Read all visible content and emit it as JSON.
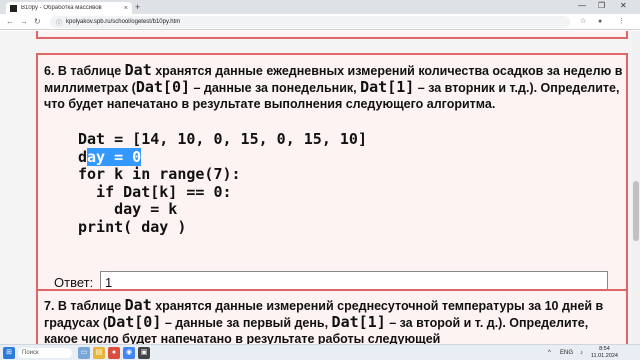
{
  "browser": {
    "tab_title": "B10py - Обработка массивов",
    "tab_close": "×",
    "new_tab": "+",
    "url": "kpolyakov.spb.ru/school/ogetest/b10py.htm",
    "win_min": "—",
    "win_max": "❐",
    "win_close": "✕"
  },
  "task6": {
    "number": "6.",
    "intro1": " В таблице ",
    "arr": "Dat",
    "intro2": " хранятся данные ежедневных измерений количества осадков за неделю в миллиметрах (",
    "arr0": "Dat[0]",
    "intro3": " – данные за понедельник, ",
    "arr1": "Dat[1]",
    "intro4": " – за вторник и т.д.). Определите, что будет напечатано в результате выполнения следующего алгоритма.",
    "code": {
      "line1": "Dat = [14, 10, 0, 15, 0, 15, 10]",
      "line2_pre": "d",
      "line2_sel": "ay = 0",
      "line3": "for k in range(7):",
      "line4": "  if Dat[k] == 0:",
      "line5": "    day = k",
      "line6": "print( day )"
    },
    "answer_label": "Ответ:",
    "answer_value": "1"
  },
  "task7": {
    "number": "7.",
    "intro1": " В таблице ",
    "arr": "Dat",
    "intro2": " хранятся данные измерений среднесуточной температуры за 10 дней в градусах (",
    "arr0": "Dat[0]",
    "intro3": " – данные за первый день, ",
    "arr1": "Dat[1]",
    "intro4": " – за второй и т. д.). Определите, какое число будет напечатано в результате работы следующей"
  },
  "taskbar": {
    "search_placeholder": "Поиск",
    "lang": "ENG",
    "time": "8:54",
    "date": "11.01.2024"
  }
}
